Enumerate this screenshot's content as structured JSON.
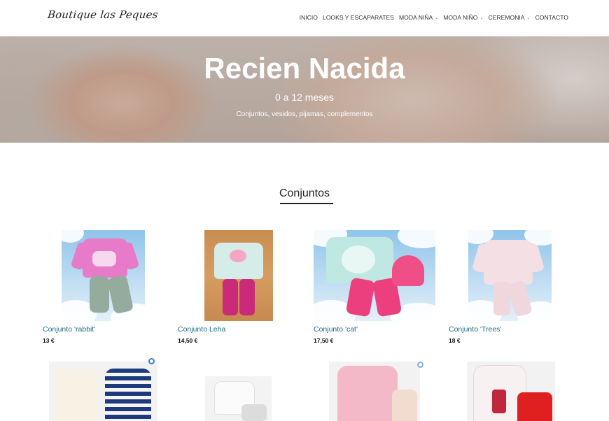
{
  "header": {
    "logo": "Boutique las Peques",
    "nav": [
      {
        "label": "INICIO",
        "dropdown": false
      },
      {
        "label": "LOOKS Y ESCAPARATES",
        "dropdown": false
      },
      {
        "label": "MODA NIÑA",
        "dropdown": true
      },
      {
        "label": "MODA NIÑO",
        "dropdown": true
      },
      {
        "label": "CEREMONIA",
        "dropdown": true
      },
      {
        "label": "CONTACTO",
        "dropdown": false
      }
    ]
  },
  "hero": {
    "title": "Recien Nacida",
    "subtitle": "0 a 12 meses",
    "description": "Conjuntos, vesidos, pijamas, complementos"
  },
  "section": {
    "title": "Conjuntos"
  },
  "products": [
    {
      "name": "Conjunto 'rabbit'",
      "price": "13 €"
    },
    {
      "name": "Conjunto Leha",
      "price": "14,50 €"
    },
    {
      "name": "Conjunto 'cat'",
      "price": "17,50 €"
    },
    {
      "name": "Conjunto 'Trees'",
      "price": "18 €"
    }
  ],
  "colors": {
    "link": "#1d6b82",
    "accent": "#3a7bd5"
  },
  "icons": {
    "chevron": "chevron-down-icon"
  }
}
